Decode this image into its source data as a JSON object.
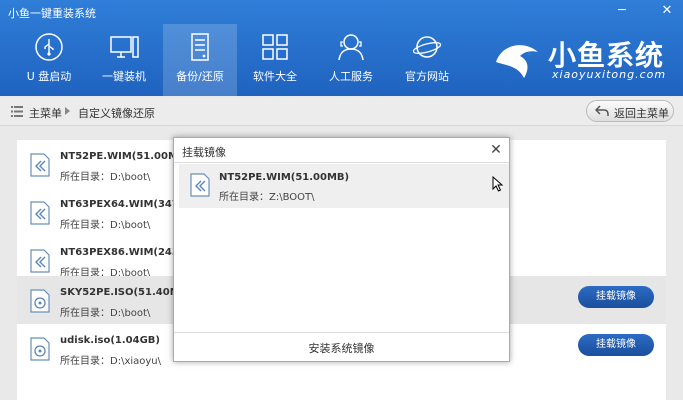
{
  "window": {
    "title": "小鱼一键重装系统",
    "min_glyph": "─",
    "close_glyph": "✕"
  },
  "nav": [
    {
      "label": "U 盘启动",
      "icon": "usb-icon"
    },
    {
      "label": "一键装机",
      "icon": "computer-icon"
    },
    {
      "label": "备份/还原",
      "icon": "backup-icon",
      "active": true
    },
    {
      "label": "软件大全",
      "icon": "apps-grid-icon"
    },
    {
      "label": "人工服务",
      "icon": "support-person-icon"
    },
    {
      "label": "官方网站",
      "icon": "planet-icon"
    }
  ],
  "brand": {
    "name": "小鱼系统",
    "url": "xiaoyuxitong.com",
    "icon": "fish-logo-icon"
  },
  "breadcrumb": {
    "home": "主菜单",
    "current": "自定义镜像还原"
  },
  "back_button": {
    "label": "返回主菜单",
    "icon": "back-arrow-icon"
  },
  "list": [
    {
      "name": "NT52PE.WIM(51.00MB)",
      "path": "所在目录：D:\\boot\\",
      "icon": "wim-file-icon"
    },
    {
      "name": "NT63PEX64.WIM(347.21MB)",
      "path": "所在目录：D:\\boot\\",
      "icon": "wim-file-icon"
    },
    {
      "name": "NT63PEX86.WIM(243.56MB)",
      "path": "所在目录：D:\\boot\\",
      "icon": "wim-file-icon"
    },
    {
      "name": "SKY52PE.ISO(51.40MB)",
      "path": "所在目录：D:\\boot\\",
      "icon": "iso-disc-icon",
      "button": "挂载镜像",
      "selected": true
    },
    {
      "name": "udisk.iso(1.04GB)",
      "path": "所在目录：D:\\xiaoyu\\",
      "icon": "iso-disc-icon",
      "button": "挂载镜像"
    }
  ],
  "modal": {
    "title": "挂载镜像",
    "close_glyph": "✕",
    "item": {
      "name": "NT52PE.WIM(51.00MB)",
      "path": "所在目录：Z:\\BOOT\\"
    },
    "install_label": "安装系统镜像"
  },
  "colors": {
    "header": "#2a74d0",
    "button": "#1f5aa8",
    "selected_row": "#e6e6e6"
  }
}
